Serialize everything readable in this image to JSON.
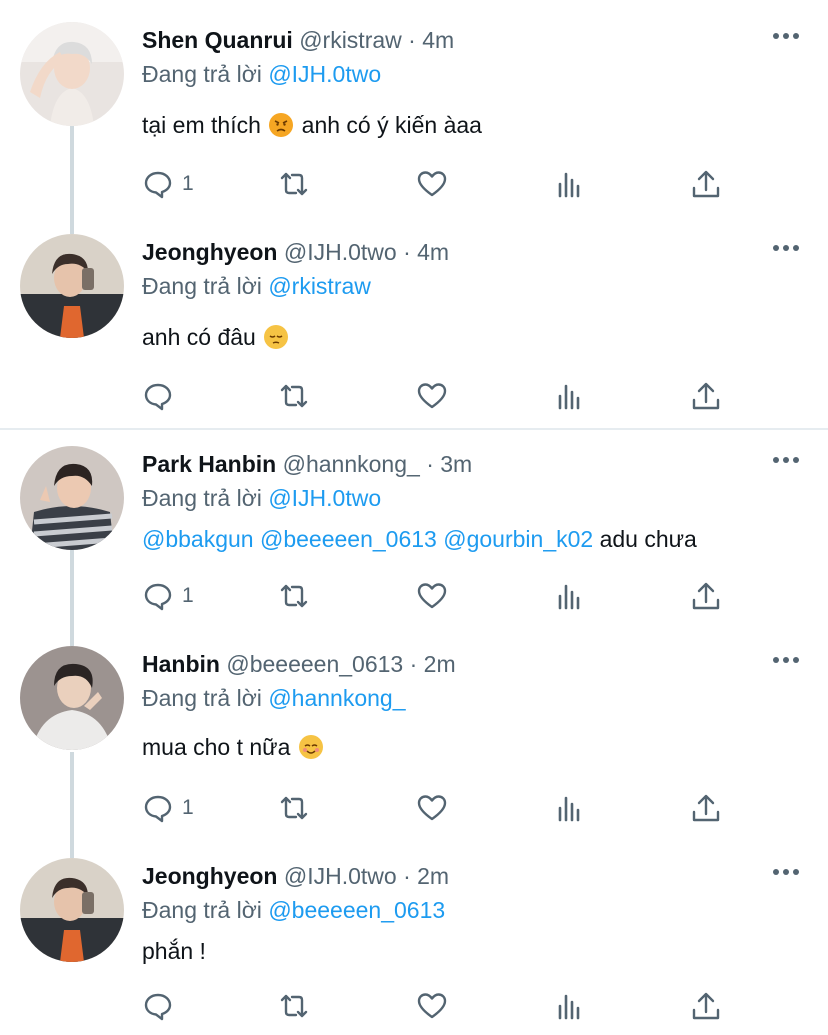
{
  "tweets": [
    {
      "name": "Shen Quanrui",
      "handle": "@rkistraw",
      "sep": "·",
      "time": "4m",
      "replying_prefix": "Đang trả lời",
      "replying_to": "@IJH.0two",
      "text_a": "tại em thích",
      "emoji_a": "angry-face",
      "text_b": "anh có ý kiến àaa",
      "reply_count": "1"
    },
    {
      "name": "Jeonghyeon",
      "handle": "@IJH.0two",
      "sep": "·",
      "time": "4m",
      "replying_prefix": "Đang trả lời",
      "replying_to": "@rkistraw",
      "text_a": "anh có đâu",
      "emoji_a": "pensive-face",
      "reply_count": ""
    },
    {
      "name": "Park Hanbin",
      "handle": "@hannkong_",
      "sep": "·",
      "time": "3m",
      "replying_prefix": "Đang trả lời",
      "replying_to": "@IJH.0two",
      "mention_1": "@bbakgun",
      "mention_2": "@beeeeen_0613",
      "mention_3": "@gourbin_k02",
      "text_a": "adu chưa",
      "reply_count": "1"
    },
    {
      "name": "Hanbin",
      "handle": "@beeeeen_0613",
      "sep": "·",
      "time": "2m",
      "replying_prefix": "Đang trả lời",
      "replying_to": "@hannkong_",
      "text_a": "mua cho t nữa",
      "emoji_a": "relieved-face",
      "reply_count": "1"
    },
    {
      "name": "Jeonghyeon",
      "handle": "@IJH.0two",
      "sep": "·",
      "time": "2m",
      "replying_prefix": "Đang trả lời",
      "replying_to": "@beeeeen_0613",
      "text_a": "phắn !",
      "reply_count": ""
    }
  ],
  "colors": {
    "link": "#1d9bf0",
    "secondary": "#536471",
    "thread_line": "#cfd9de"
  },
  "icons": [
    "reply-icon",
    "retweet-icon",
    "like-icon",
    "views-icon",
    "share-icon",
    "more-icon"
  ]
}
